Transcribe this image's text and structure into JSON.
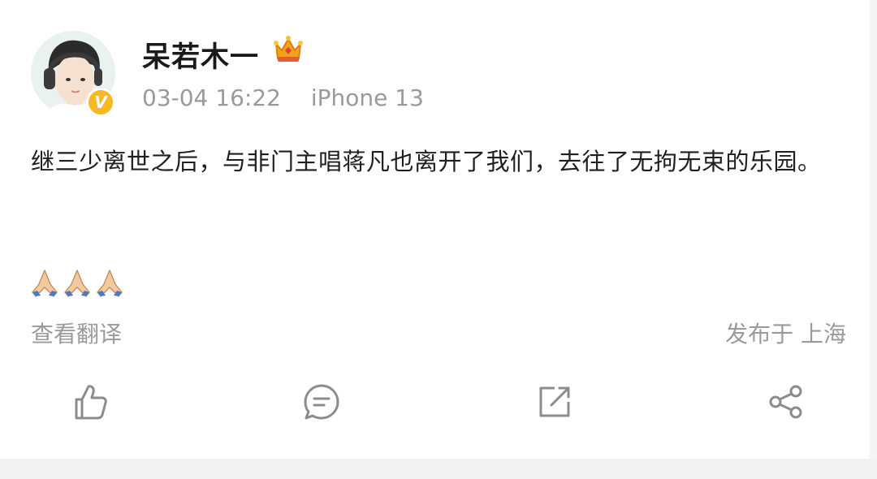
{
  "post": {
    "username": "呆若木一",
    "timestamp": "03-04 16:22",
    "device": "iPhone 13",
    "content": "继三少离世之后，与非门主唱蒋凡也离开了我们，去往了无拘无束的乐园。",
    "emoji": [
      "🙏",
      "🙏",
      "🙏"
    ],
    "translate_label": "查看翻译",
    "location": "发布于 上海"
  },
  "badges": {
    "verified_text": "V",
    "verified_color": "#f6b921",
    "crown_icon": "crown-icon"
  },
  "actions": [
    {
      "name": "like",
      "icon": "thumbs-up-icon"
    },
    {
      "name": "comment",
      "icon": "comment-icon"
    },
    {
      "name": "forward",
      "icon": "forward-icon"
    },
    {
      "name": "share",
      "icon": "share-icon"
    }
  ]
}
